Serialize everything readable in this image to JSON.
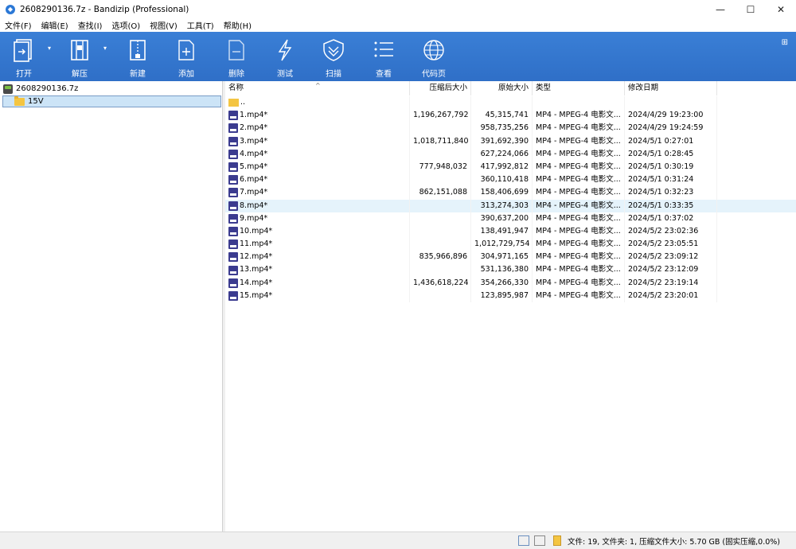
{
  "window": {
    "title": "2608290136.7z - Bandizip (Professional)",
    "controls": {
      "minimize": "—",
      "maximize": "☐",
      "close": "✕"
    }
  },
  "menu": [
    "文件(F)",
    "编辑(E)",
    "查找(I)",
    "选项(O)",
    "视图(V)",
    "工具(T)",
    "帮助(H)"
  ],
  "toolbar": {
    "open": "打开",
    "extract": "解压",
    "new": "新建",
    "add": "添加",
    "delete": "删除",
    "test": "测试",
    "scan": "扫描",
    "view": "查看",
    "codepage": "代码页"
  },
  "tree": {
    "root": "2608290136.7z",
    "child": "15V"
  },
  "columns": {
    "name": "名称",
    "compressed": "压缩后大小",
    "original": "原始大小",
    "type": "类型",
    "modified": "修改日期"
  },
  "files": [
    {
      "name": "..",
      "compressed": "",
      "original": "",
      "type": "",
      "modified": "",
      "folder": true
    },
    {
      "name": "1.mp4*",
      "compressed": "1,196,267,792",
      "original": "45,315,741",
      "type": "MP4 - MPEG-4 电影文...",
      "modified": "2024/4/29 19:23:00"
    },
    {
      "name": "2.mp4*",
      "compressed": "",
      "original": "958,735,256",
      "type": "MP4 - MPEG-4 电影文...",
      "modified": "2024/4/29 19:24:59"
    },
    {
      "name": "3.mp4*",
      "compressed": "1,018,711,840",
      "original": "391,692,390",
      "type": "MP4 - MPEG-4 电影文...",
      "modified": "2024/5/1 0:27:01"
    },
    {
      "name": "4.mp4*",
      "compressed": "",
      "original": "627,224,066",
      "type": "MP4 - MPEG-4 电影文...",
      "modified": "2024/5/1 0:28:45"
    },
    {
      "name": "5.mp4*",
      "compressed": "777,948,032",
      "original": "417,992,812",
      "type": "MP4 - MPEG-4 电影文...",
      "modified": "2024/5/1 0:30:19"
    },
    {
      "name": "6.mp4*",
      "compressed": "",
      "original": "360,110,418",
      "type": "MP4 - MPEG-4 电影文...",
      "modified": "2024/5/1 0:31:24"
    },
    {
      "name": "7.mp4*",
      "compressed": "862,151,088",
      "original": "158,406,699",
      "type": "MP4 - MPEG-4 电影文...",
      "modified": "2024/5/1 0:32:23"
    },
    {
      "name": "8.mp4*",
      "compressed": "",
      "original": "313,274,303",
      "type": "MP4 - MPEG-4 电影文...",
      "modified": "2024/5/1 0:33:35",
      "selected": true
    },
    {
      "name": "9.mp4*",
      "compressed": "",
      "original": "390,637,200",
      "type": "MP4 - MPEG-4 电影文...",
      "modified": "2024/5/1 0:37:02"
    },
    {
      "name": "10.mp4*",
      "compressed": "",
      "original": "138,491,947",
      "type": "MP4 - MPEG-4 电影文...",
      "modified": "2024/5/2 23:02:36"
    },
    {
      "name": "11.mp4*",
      "compressed": "",
      "original": "1,012,729,754",
      "type": "MP4 - MPEG-4 电影文...",
      "modified": "2024/5/2 23:05:51"
    },
    {
      "name": "12.mp4*",
      "compressed": "835,966,896",
      "original": "304,971,165",
      "type": "MP4 - MPEG-4 电影文...",
      "modified": "2024/5/2 23:09:12"
    },
    {
      "name": "13.mp4*",
      "compressed": "",
      "original": "531,136,380",
      "type": "MP4 - MPEG-4 电影文...",
      "modified": "2024/5/2 23:12:09"
    },
    {
      "name": "14.mp4*",
      "compressed": "1,436,618,224",
      "original": "354,266,330",
      "type": "MP4 - MPEG-4 电影文...",
      "modified": "2024/5/2 23:19:14"
    },
    {
      "name": "15.mp4*",
      "compressed": "",
      "original": "123,895,987",
      "type": "MP4 - MPEG-4 电影文...",
      "modified": "2024/5/2 23:20:01"
    }
  ],
  "status": {
    "summary": "文件: 19, 文件夹: 1, 压缩文件大小: 5.70 GB (固实压缩,0.0%)"
  }
}
